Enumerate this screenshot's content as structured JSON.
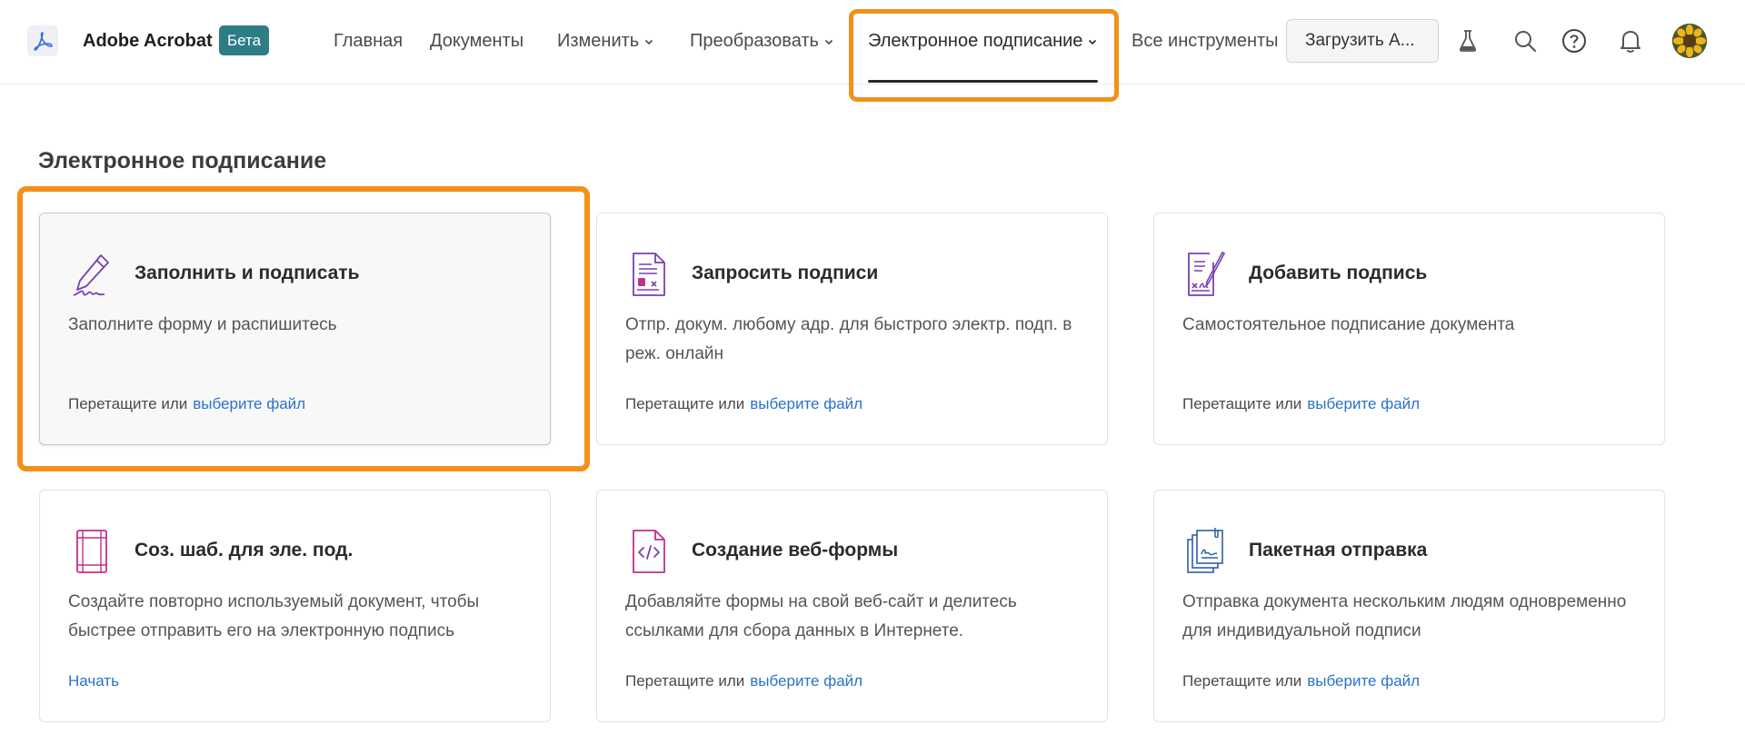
{
  "header": {
    "app_name": "Adobe Acrobat",
    "beta_badge": "Бета",
    "nav": [
      {
        "label": "Главная"
      },
      {
        "label": "Документы"
      },
      {
        "label": "Изменить"
      },
      {
        "label": "Преобразовать"
      },
      {
        "label": "Электронное подписание"
      },
      {
        "label": "Все инструменты"
      }
    ],
    "active_nav": "Электронное подписание",
    "upload_label": "Загрузить А..."
  },
  "main": {
    "section_title": "Электронное подписание",
    "cards": [
      {
        "title": "Заполнить и подписать",
        "desc": "Заполните форму и распишитесь",
        "foot_text": "Перетащите или",
        "foot_link": "выберите файл",
        "icon": "fill-sign-icon"
      },
      {
        "title": "Запросить подписи",
        "desc": "Отпр. докум. любому адр. для быстрого электр. подп. в реж. онлайн",
        "foot_text": "Перетащите или",
        "foot_link": "выберите файл",
        "icon": "request-signatures-icon"
      },
      {
        "title": "Добавить подпись",
        "desc": "Самостоятельное подписание документа",
        "foot_text": "Перетащите или",
        "foot_link": "выберите файл",
        "icon": "add-signature-icon"
      },
      {
        "title": "Соз. шаб. для эле. под.",
        "desc": "Создайте повторно используемый документ, чтобы быстрее отправить его на электронную подпись",
        "foot_link": "Начать",
        "icon": "template-icon"
      },
      {
        "title": "Создание веб-формы",
        "desc": "Добавляйте формы на свой веб-сайт и делитесь ссылками для сбора данных в Интернете.",
        "foot_text": "Перетащите или",
        "foot_link": "выберите файл",
        "icon": "web-form-icon"
      },
      {
        "title": "Пакетная отправка",
        "desc": "Отправка документа нескольким людям одновременно для индивидуальной подписи",
        "foot_text": "Перетащите или",
        "foot_link": "выберите файл",
        "icon": "bulk-send-icon"
      }
    ]
  },
  "colors": {
    "accent_highlight": "#f39019",
    "link": "#2b72c9",
    "beta": "#2d7d85",
    "icon_purple": "#7a3fb0"
  }
}
